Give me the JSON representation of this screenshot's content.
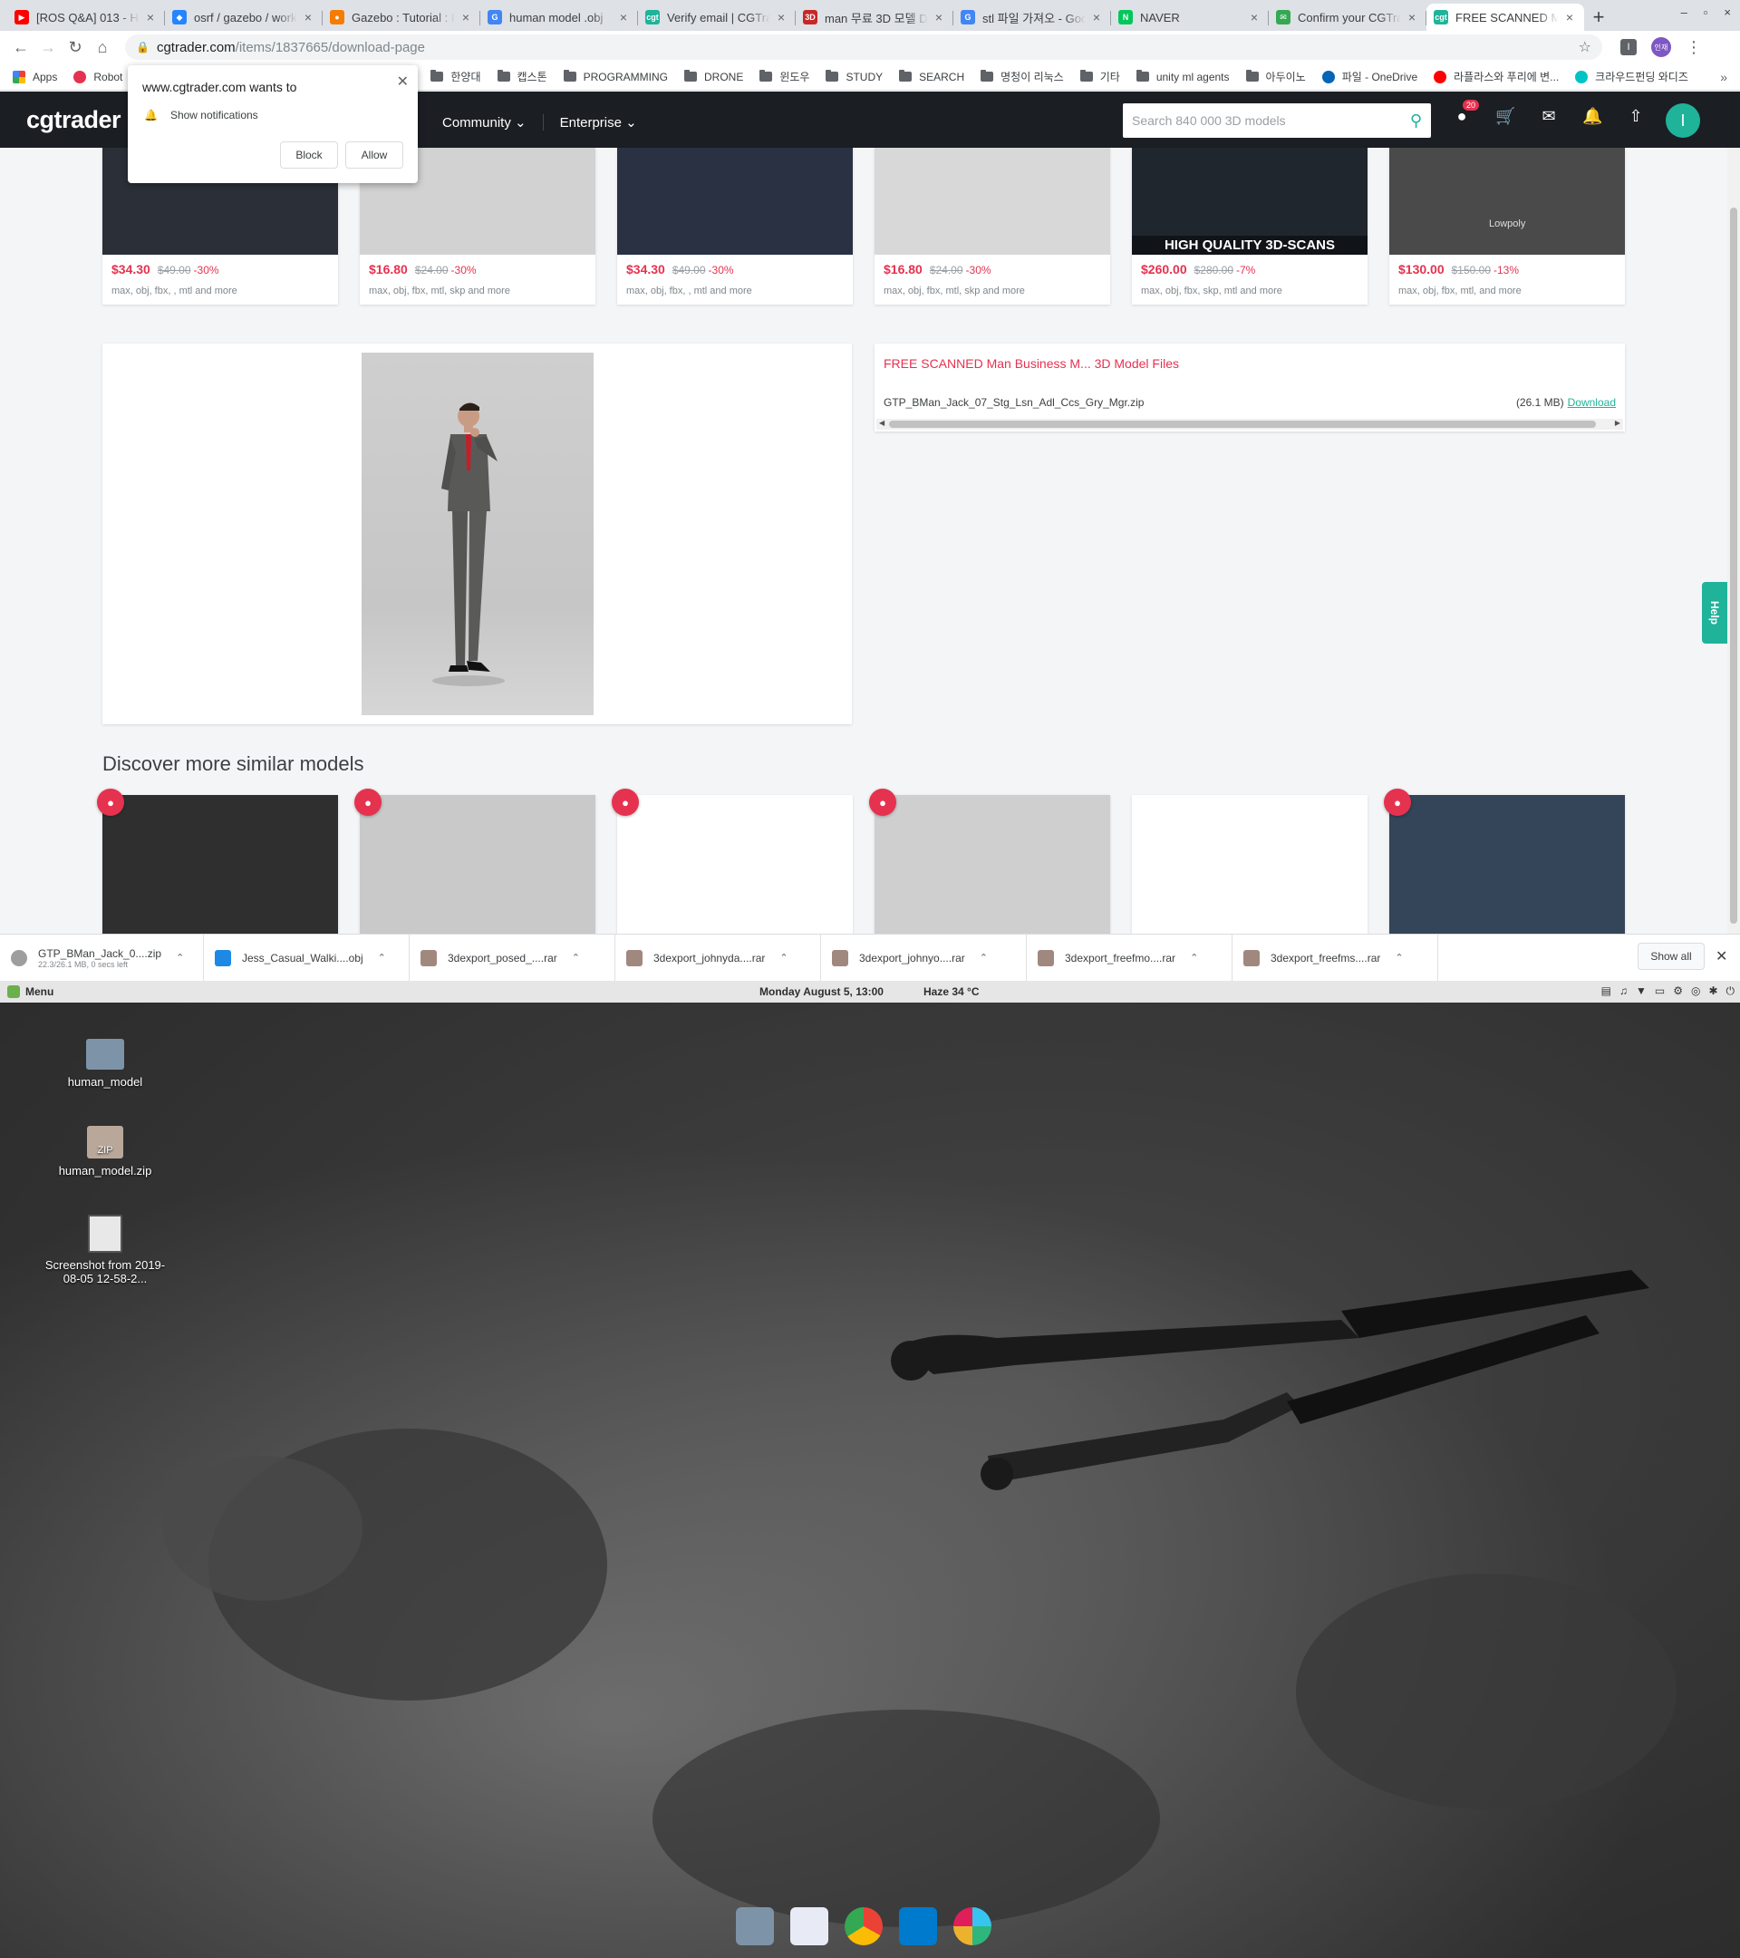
{
  "browser": {
    "tabs": [
      {
        "label": "[ROS Q&A] 013 - Ho",
        "fav_color": "#ff0000",
        "fav_glyph": "▶"
      },
      {
        "label": "osrf / gazebo / work",
        "fav_color": "#2684ff",
        "fav_glyph": "◆"
      },
      {
        "label": "Gazebo : Tutorial : F",
        "fav_color": "#f57c00",
        "fav_glyph": "●"
      },
      {
        "label": "human model .obj",
        "fav_color": "#4285f4",
        "fav_glyph": "G"
      },
      {
        "label": "Verify email | CGTra",
        "fav_color": "#1fb39a",
        "fav_glyph": "cgt"
      },
      {
        "label": "man 무료 3D 모델 D",
        "fav_color": "#c62828",
        "fav_glyph": "3D"
      },
      {
        "label": "stl 파일 가져오 - Goo",
        "fav_color": "#4285f4",
        "fav_glyph": "G"
      },
      {
        "label": "NAVER",
        "fav_color": "#03c75a",
        "fav_glyph": "N"
      },
      {
        "label": "Confirm your CGTra",
        "fav_color": "#34a853",
        "fav_glyph": "✉"
      },
      {
        "label": "FREE SCANNED Man",
        "fav_color": "#1fb39a",
        "fav_glyph": "cgt"
      }
    ],
    "url_host": "cgtrader.com",
    "url_path": "/items/1837665/download-page",
    "profile_label": "인재",
    "bookmarks": [
      {
        "label": "Apps",
        "kind": "apps"
      },
      {
        "label": "Robot",
        "kind": "dot",
        "color": "#e5324f"
      },
      {
        "label": "한양대",
        "kind": "folder"
      },
      {
        "label": "캡스톤",
        "kind": "folder"
      },
      {
        "label": "PROGRAMMING",
        "kind": "folder"
      },
      {
        "label": "DRONE",
        "kind": "folder"
      },
      {
        "label": "윈도우",
        "kind": "folder"
      },
      {
        "label": "STUDY",
        "kind": "folder"
      },
      {
        "label": "SEARCH",
        "kind": "folder"
      },
      {
        "label": "명청이 리눅스",
        "kind": "folder"
      },
      {
        "label": "기타",
        "kind": "folder"
      },
      {
        "label": "unity ml agents",
        "kind": "folder"
      },
      {
        "label": "아두이노",
        "kind": "folder"
      },
      {
        "label": "파일 - OneDrive",
        "kind": "dot",
        "color": "#0364b8"
      },
      {
        "label": "라플라스와 푸리에 변...",
        "kind": "dot",
        "color": "#ff0000"
      },
      {
        "label": "크라우드펀딩 와디즈",
        "kind": "dot",
        "color": "#00c4c4"
      }
    ]
  },
  "notification": {
    "title": "www.cgtrader.com wants to",
    "line": "Show notifications",
    "block": "Block",
    "allow": "Allow"
  },
  "cg": {
    "logo": "cgtrader",
    "nav": [
      "Community",
      "Enterprise"
    ],
    "search_placeholder": "Search 840 000 3D models",
    "cart_badge": "20",
    "avatar_letter": "I",
    "top_cards": [
      {
        "price": "$34.30",
        "old": "$49.00",
        "disc": "-30%",
        "formats": "max, obj, fbx, , mtl and more",
        "thumb": "#2b2f38"
      },
      {
        "price": "$16.80",
        "old": "$24.00",
        "disc": "-30%",
        "formats": "max, obj, fbx, mtl, skp and more",
        "thumb": "#d2d2d2"
      },
      {
        "price": "$34.30",
        "old": "$49.00",
        "disc": "-30%",
        "formats": "max, obj, fbx, , mtl and more",
        "thumb": "#2a3142"
      },
      {
        "price": "$16.80",
        "old": "$24.00",
        "disc": "-30%",
        "formats": "max, obj, fbx, mtl, skp and more",
        "thumb": "#d8d8d8"
      },
      {
        "price": "$260.00",
        "old": "$280.00",
        "disc": "-7%",
        "formats": "max, obj, fbx, skp, mtl and more",
        "thumb": "#20262e",
        "banner": "HIGH QUALITY 3D-SCANS"
      },
      {
        "price": "$130.00",
        "old": "$150.00",
        "disc": "-13%",
        "formats": "max, obj, fbx, mtl, and more",
        "thumb": "#4a4a4a",
        "tag": "Lowpoly"
      }
    ],
    "files": {
      "title": "FREE SCANNED Man Business M... 3D Model Files",
      "filename": "GTP_BMan_Jack_07_Stg_Lsn_Adl_Ccs_Gry_Mgr.zip",
      "size": "(26.1 MB)",
      "download": "Download"
    },
    "discover_title": "Discover more similar models",
    "similar": [
      {
        "thumb": "#2f2f2f",
        "heart": true
      },
      {
        "thumb": "#c9c9c9",
        "heart": true
      },
      {
        "thumb": "#ffffff",
        "heart": true
      },
      {
        "thumb": "#cfcfcf",
        "heart": true
      },
      {
        "thumb": "#ffffff",
        "heart": false
      },
      {
        "thumb": "#344459",
        "heart": true
      }
    ],
    "help": "Help"
  },
  "downloads": {
    "items": [
      {
        "name": "GTP_BMan_Jack_0....zip",
        "sub": "22.3/26.1 MB, 0 secs left",
        "color": "#9e9e9e"
      },
      {
        "name": "Jess_Casual_Walki....obj",
        "sub": "",
        "color": "#1e88e5"
      },
      {
        "name": "3dexport_posed_....rar",
        "sub": "",
        "color": "#a1887f"
      },
      {
        "name": "3dexport_johnyda....rar",
        "sub": "",
        "color": "#a1887f"
      },
      {
        "name": "3dexport_johnyo....rar",
        "sub": "",
        "color": "#a1887f"
      },
      {
        "name": "3dexport_freefmo....rar",
        "sub": "",
        "color": "#a1887f"
      },
      {
        "name": "3dexport_freefms....rar",
        "sub": "",
        "color": "#a1887f"
      }
    ],
    "show_all": "Show all"
  },
  "panel": {
    "menu": "Menu",
    "clock": "Monday August  5, 13:00",
    "weather": "Haze 34 °C"
  },
  "desktop": {
    "icons": [
      {
        "label": "human_model",
        "kind": "folder"
      },
      {
        "label": "human_model.zip",
        "kind": "zip"
      },
      {
        "label": "Screenshot from 2019-08-05 12-58-2...",
        "kind": "image"
      }
    ],
    "dock": [
      {
        "name": "files",
        "color": "#7d93a8"
      },
      {
        "name": "text-editor",
        "color": "#e8eaf6"
      },
      {
        "name": "chrome",
        "color": "#4285f4"
      },
      {
        "name": "vscode",
        "color": "#007acc"
      },
      {
        "name": "slack",
        "color": "#ffffff"
      }
    ]
  }
}
